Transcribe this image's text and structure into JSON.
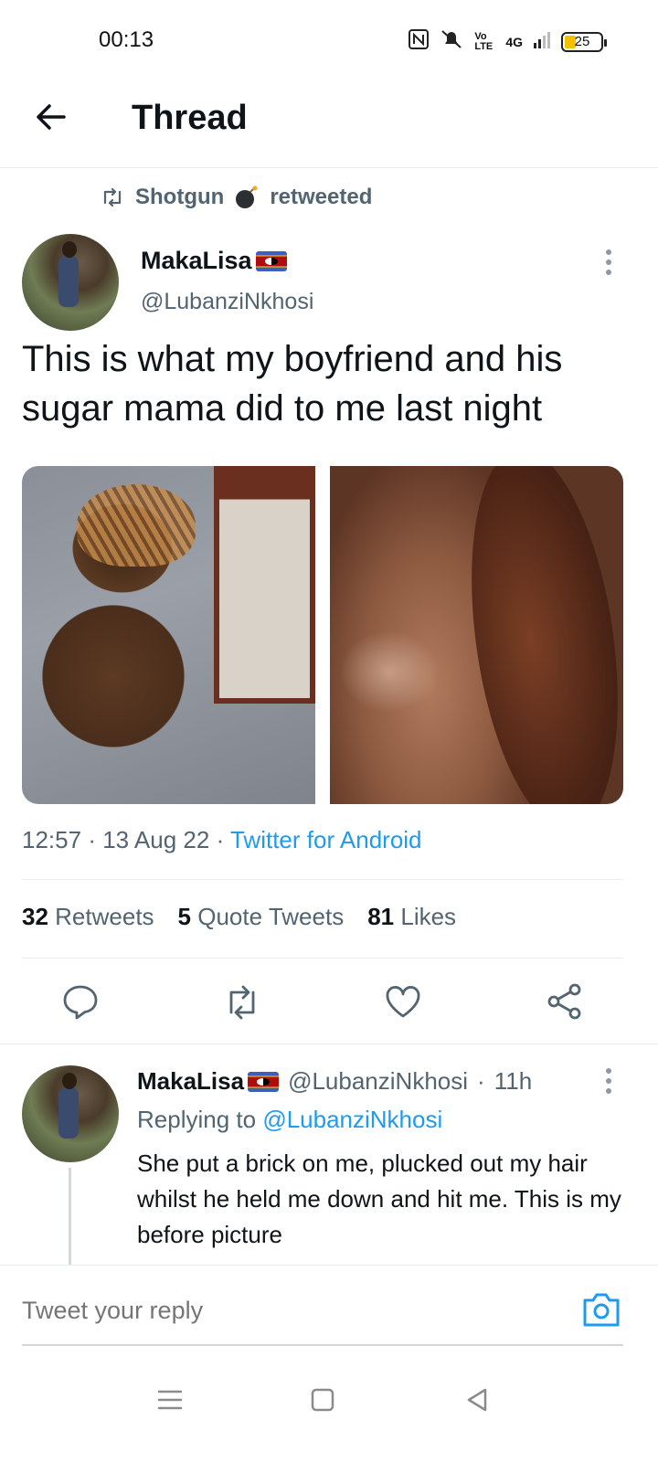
{
  "status_bar": {
    "time": "00:13",
    "network": "4G",
    "volte": "Vo LTE",
    "battery": "25"
  },
  "header": {
    "title": "Thread"
  },
  "retweet_note": {
    "user": "Shotgun",
    "action": "retweeted"
  },
  "tweet": {
    "name": "MakaLisa",
    "handle": "@LubanziNkhosi",
    "text": "This is what my boyfriend and his sugar mama did to me last night",
    "time": "12:57",
    "date": "13 Aug 22",
    "source": "Twitter for Android",
    "stats": {
      "retweets_count": "32",
      "retweets_label": "Retweets",
      "quotes_count": "5",
      "quotes_label": "Quote Tweets",
      "likes_count": "81",
      "likes_label": "Likes"
    }
  },
  "reply": {
    "name": "MakaLisa",
    "handle": "@LubanziNkhosi",
    "age": "11h",
    "replying_label": "Replying to",
    "replying_to": "@LubanziNkhosi",
    "text": "She put a brick on me, plucked out my hair whilst he held me down and hit me. This is my before picture"
  },
  "composer": {
    "placeholder": "Tweet your reply"
  },
  "colors": {
    "accent": "#1d9bf0",
    "secondary_text": "#536471",
    "primary_text": "#0f1419",
    "divider": "#e6ecf0"
  },
  "icons": [
    "back-arrow-icon",
    "retweet-icon",
    "more-icon",
    "reply-icon",
    "like-icon",
    "share-icon",
    "camera-icon",
    "menu-icon",
    "home-square-icon",
    "back-triangle-icon"
  ]
}
